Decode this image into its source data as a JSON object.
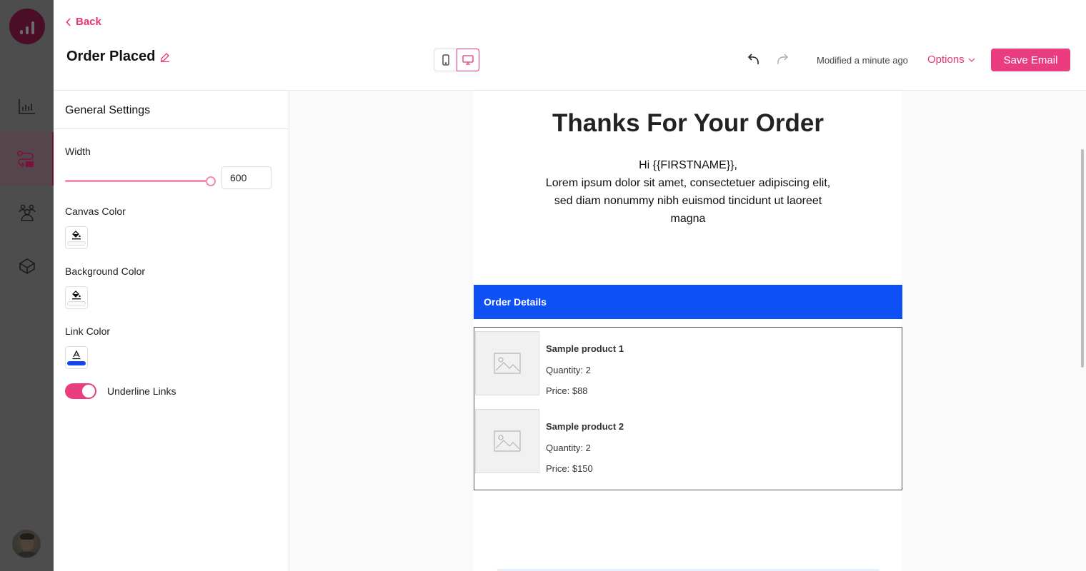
{
  "app": {
    "brand_color": "#e8357a",
    "rail": {
      "logo": "analytics-logo-icon",
      "items": [
        {
          "icon": "bar-chart-icon",
          "label": "Reports",
          "active": false
        },
        {
          "icon": "automation-flow-icon",
          "label": "Automations",
          "active": true
        },
        {
          "icon": "contacts-group-icon",
          "label": "Contacts",
          "active": false
        },
        {
          "icon": "box-icon",
          "label": "Integrations",
          "active": false
        }
      ],
      "avatar": "user-avatar"
    }
  },
  "header": {
    "back_label": "Back",
    "title": "Order Placed",
    "device_modes": [
      {
        "name": "mobile",
        "icon": "mobile-icon",
        "selected": false
      },
      {
        "name": "desktop",
        "icon": "desktop-icon",
        "selected": true
      }
    ],
    "modified_text": "Modified a minute ago",
    "options_label": "Options",
    "save_label": "Save Email"
  },
  "settings": {
    "heading": "General Settings",
    "width_label": "Width",
    "width_value": "600",
    "width_slider_fraction": 1.0,
    "canvas_color_label": "Canvas Color",
    "background_color_label": "Background Color",
    "link_color_label": "Link Color",
    "link_color": "#1547e8",
    "underline_links_label": "Underline Links",
    "underline_links_on": true
  },
  "email": {
    "title": "Thanks For Your Order",
    "greeting": "Hi {{FIRSTNAME}},",
    "body": "Lorem ipsum dolor sit amet, consectetuer adipiscing elit, sed diam nonummy nibh euismod tincidunt ut laoreet magna",
    "order_header": "Order Details",
    "order_header_color": "#0f50f5",
    "products": [
      {
        "name": "Sample product 1",
        "quantity": "Quantity: 2",
        "price": "Price: $88"
      },
      {
        "name": "Sample product 2",
        "quantity": "Quantity: 2",
        "price": "Price: $150"
      }
    ]
  }
}
